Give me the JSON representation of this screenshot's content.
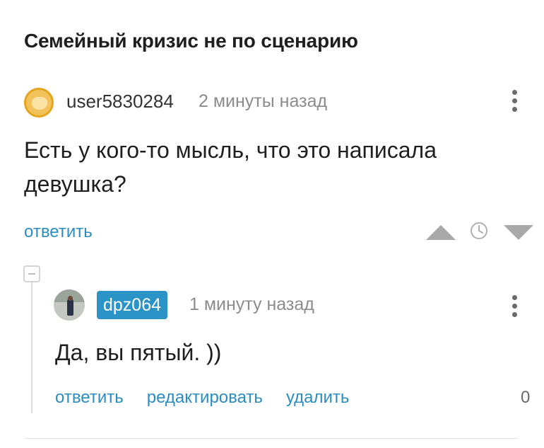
{
  "post": {
    "title": "Семейный кризис не по сценарию"
  },
  "comment": {
    "author": "user5830284",
    "time": "2 минуты назад",
    "text": "Есть у кого-то мысль, что это написала девушка?",
    "reply_label": "ответить"
  },
  "reply": {
    "author": "dpz064",
    "time": "1 минуту назад",
    "text": "Да, вы пятый. ))",
    "actions": [
      "ответить",
      "редактировать",
      "удалить"
    ],
    "rating": "0"
  },
  "icons": {
    "avatar1": "avatar-icon",
    "menu": "more-vertical-icon",
    "vote_up": "vote-up-icon",
    "clock": "clock-icon",
    "vote_down": "vote-down-icon",
    "collapse": "collapse-icon"
  },
  "colors": {
    "accent": "#2c8dc3",
    "author_badge": "#2b93c6"
  }
}
